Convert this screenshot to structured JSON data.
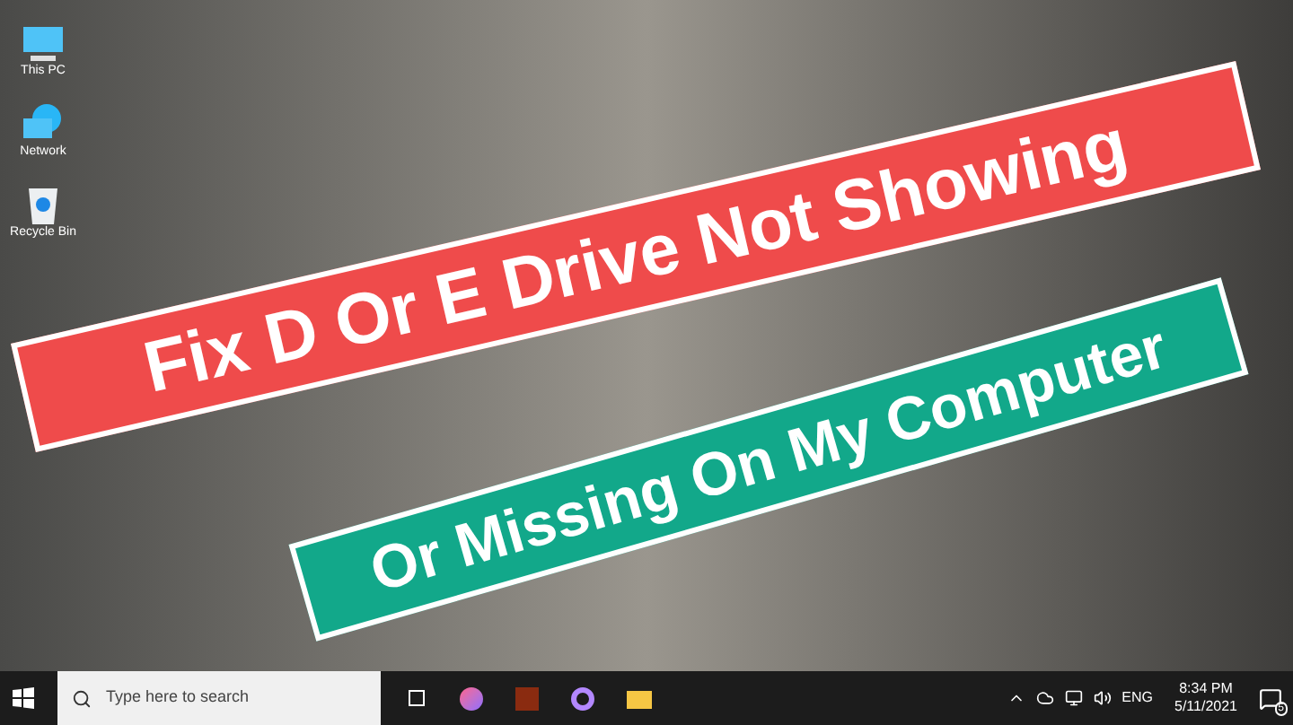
{
  "desktop_icons": [
    {
      "label": "This PC",
      "kind": "pc"
    },
    {
      "label": "Network",
      "kind": "network"
    },
    {
      "label": "Recycle Bin",
      "kind": "bin"
    }
  ],
  "banners": [
    {
      "text": "Fix D Or E Drive Not Showing",
      "color": "#ef4b4b"
    },
    {
      "text": "Or Missing On My Computer",
      "color": "#12a88a"
    }
  ],
  "taskbar": {
    "search": {
      "placeholder": "Type here to search"
    },
    "language": "ENG",
    "time": "8:34 PM",
    "date": "5/11/2021",
    "notifications": "5"
  }
}
